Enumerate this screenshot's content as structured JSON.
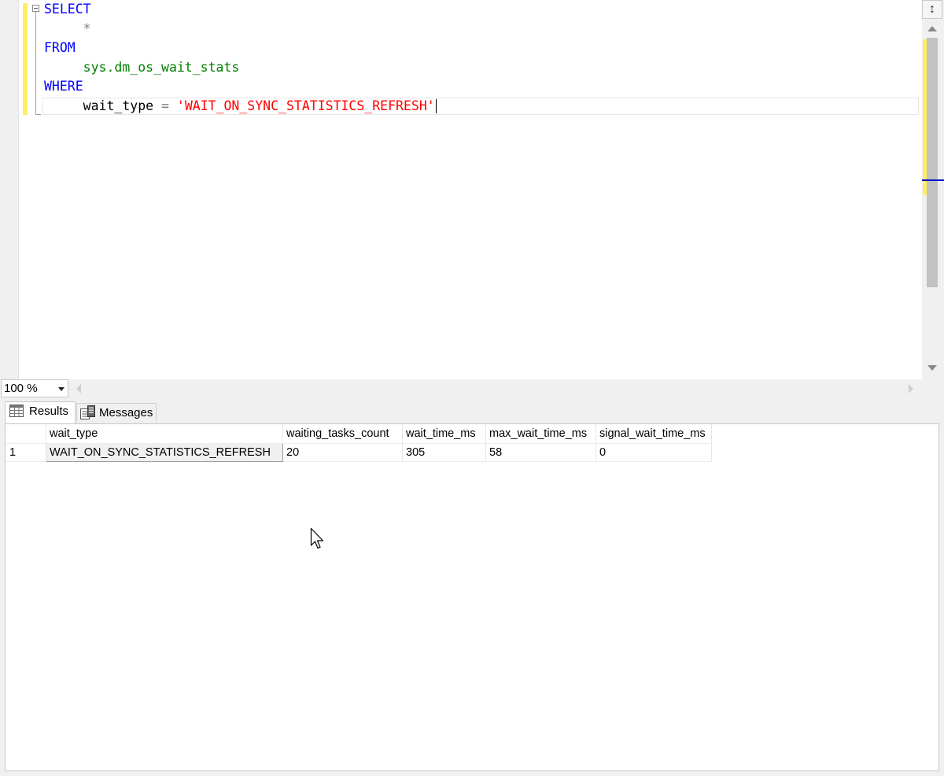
{
  "editor": {
    "lines": [
      [
        {
          "t": "SELECT",
          "c": "kw"
        }
      ],
      [
        {
          "t": "     *",
          "c": "op"
        }
      ],
      [
        {
          "t": "FROM",
          "c": "kw"
        }
      ],
      [
        {
          "t": "     ",
          "c": "plain"
        },
        {
          "t": "sys.dm_os_wait_stats",
          "c": "obj"
        }
      ],
      [
        {
          "t": "WHERE",
          "c": "kw"
        }
      ],
      [
        {
          "t": "     wait_type ",
          "c": "plain"
        },
        {
          "t": "=",
          "c": "op"
        },
        {
          "t": " ",
          "c": "plain"
        },
        {
          "t": "'WAIT_ON_SYNC_STATISTICS_REFRESH'",
          "c": "str"
        }
      ]
    ]
  },
  "zoom": {
    "value": "100 %"
  },
  "tabs": {
    "results": "Results",
    "messages": "Messages"
  },
  "grid": {
    "columns": [
      "wait_type",
      "waiting_tasks_count",
      "wait_time_ms",
      "max_wait_time_ms",
      "signal_wait_time_ms"
    ],
    "rows": [
      {
        "num": "1",
        "cells": [
          "WAIT_ON_SYNC_STATISTICS_REFRESH",
          "20",
          "305",
          "58",
          "0"
        ]
      }
    ]
  },
  "colors": {
    "keyword": "#0000ff",
    "object": "#008000",
    "string": "#ff0000",
    "operator": "#808080",
    "changeMarker": "#ffee62"
  },
  "icons": {
    "split": "split-icon",
    "results": "grid-icon",
    "messages": "messages-icon",
    "cursor": "mouse-pointer-icon"
  }
}
